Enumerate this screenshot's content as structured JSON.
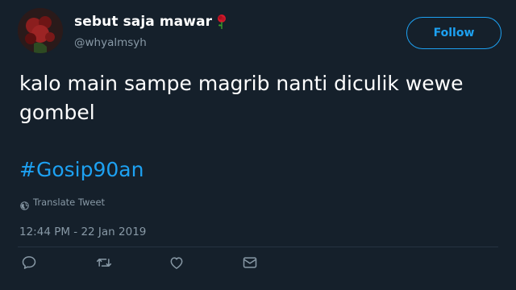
{
  "user": {
    "display_name": "sebut saja mawar",
    "handle": "@whyalmsyh",
    "name_emoji_icon": "rose-icon"
  },
  "follow_button": {
    "label": "Follow"
  },
  "tweet": {
    "text": "kalo main sampe magrib nanti diculik wewe\ngombel",
    "hashtag": "#Gosip90an",
    "translate_label": "Translate Tweet",
    "timestamp": "12:44 PM - 22 Jan 2019"
  },
  "actions": [
    {
      "name": "reply",
      "icon": "reply-icon"
    },
    {
      "name": "retweet",
      "icon": "retweet-icon"
    },
    {
      "name": "like",
      "icon": "heart-icon"
    },
    {
      "name": "direct-message",
      "icon": "envelope-icon"
    }
  ],
  "colors": {
    "background": "#15202b",
    "accent": "#1da1f2",
    "secondary_text": "#8899a6",
    "primary_text": "#ffffff"
  }
}
